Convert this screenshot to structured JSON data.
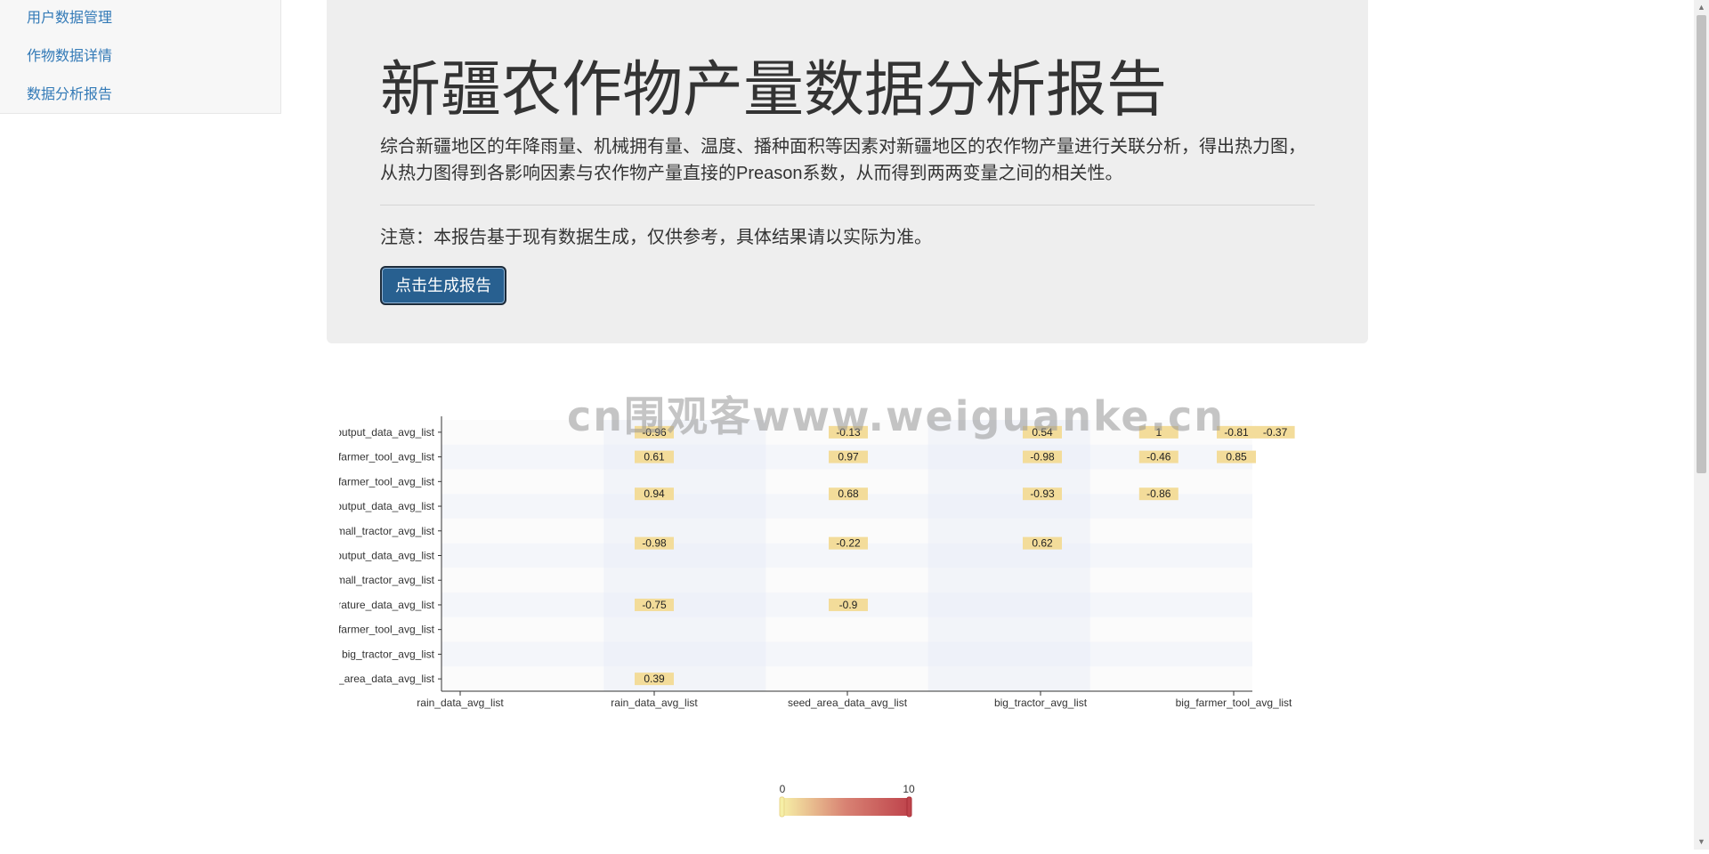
{
  "sidebar": {
    "items": [
      {
        "label": "用户数据管理"
      },
      {
        "label": "作物数据详情"
      },
      {
        "label": "数据分析报告"
      }
    ]
  },
  "report": {
    "title": "新疆农作物产量数据分析报告",
    "description": "综合新疆地区的年降雨量、机械拥有量、温度、播种面积等因素对新疆地区的农作物产量进行关联分析，得出热力图，从热力图得到各影响因素与农作物产量直接的Preason系数，从而得到两两变量之间的相关性。",
    "note": "注意：本报告基于现有数据生成，仅供参考，具体结果请以实际为准。",
    "button_label": "点击生成报告"
  },
  "watermark": "cn围观客www.weiguanke.cn",
  "chart_data": {
    "type": "heatmap",
    "title": "",
    "x_axis_tick_labels": [
      "rain_data_avg_list",
      "rain_data_avg_list",
      "seed_area_data_avg_list",
      "big_tractor_avg_list",
      "big_farmer_tool_avg_list"
    ],
    "y_axis_tick_labels": [
      "output_data_avg_list",
      "farmer_tool_avg_list",
      "farmer_tool_avg_list",
      "output_data_avg_list",
      "small_tractor_avg_list",
      "output_data_avg_list",
      "small_tractor_avg_list",
      "temperature_data_avg_list",
      "farmer_tool_avg_list",
      "big_tractor_avg_list",
      "seed_area_data_avg_list"
    ],
    "cells": [
      {
        "x": 1,
        "y": 0,
        "value": -0.96
      },
      {
        "x": 2,
        "y": 0,
        "value": -0.13
      },
      {
        "x": 3,
        "y": 0,
        "value": 0.54
      },
      {
        "x": 3.6,
        "y": 0,
        "value": 1
      },
      {
        "x": 4,
        "y": 0,
        "value": -0.81
      },
      {
        "x": 4.2,
        "y": 0,
        "value": -0.37
      },
      {
        "x": 1,
        "y": 1,
        "value": 0.61
      },
      {
        "x": 2,
        "y": 1,
        "value": 0.97
      },
      {
        "x": 3,
        "y": 1,
        "value": -0.98
      },
      {
        "x": 3.6,
        "y": 1,
        "value": -0.46
      },
      {
        "x": 4,
        "y": 1,
        "value": 0.85
      },
      {
        "x": 1,
        "y": 2.5,
        "value": 0.94
      },
      {
        "x": 2,
        "y": 2.5,
        "value": 0.68
      },
      {
        "x": 3,
        "y": 2.5,
        "value": -0.93
      },
      {
        "x": 3.6,
        "y": 2.5,
        "value": -0.86
      },
      {
        "x": 1,
        "y": 4.5,
        "value": -0.98
      },
      {
        "x": 2,
        "y": 4.5,
        "value": -0.22
      },
      {
        "x": 3,
        "y": 4.5,
        "value": 0.62
      },
      {
        "x": 1,
        "y": 7,
        "value": -0.75
      },
      {
        "x": 2,
        "y": 7,
        "value": -0.9
      },
      {
        "x": 1,
        "y": 10,
        "value": 0.39
      }
    ],
    "visual_map": {
      "min": 0,
      "max": 10,
      "min_label": "0",
      "max_label": "10",
      "colors": [
        "#f6efa6",
        "#d88273",
        "#bf444c"
      ]
    },
    "cell_color": "#f3dc9a"
  }
}
